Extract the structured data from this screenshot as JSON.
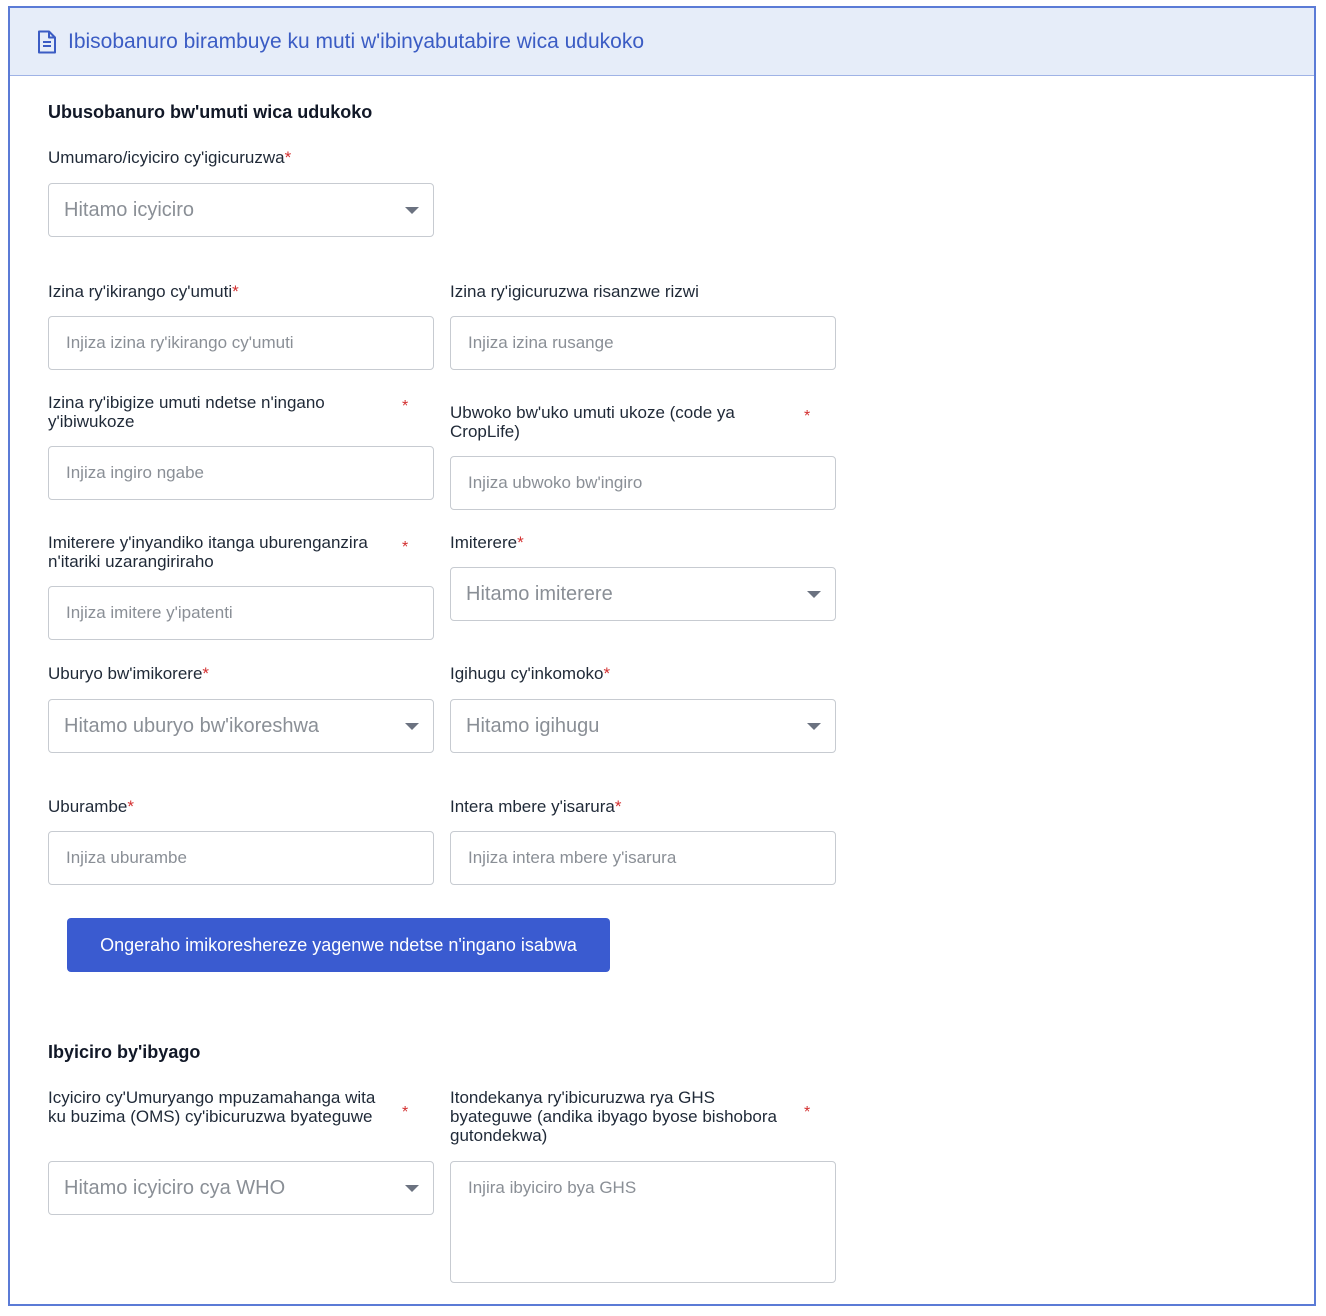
{
  "header": {
    "title": "Ibisobanuro birambuye ku muti w'ibinyabutabire wica udukoko",
    "icon": "document-icon"
  },
  "section1": {
    "title": "Ubusobanuro bw'umuti wica udukoko",
    "category": {
      "label": "Umumaro/icyiciro cy'igicuruzwa",
      "selected": "Hitamo icyiciro"
    },
    "brand_name": {
      "label": "Izina ry'ikirango cy'umuti",
      "placeholder": "Injiza izina ry'ikirango cy'umuti"
    },
    "common_name": {
      "label": "Izina ry'igicuruzwa risanzwe rizwi",
      "placeholder": "Injiza izina rusange"
    },
    "ingredients": {
      "label": "Izina ry'ibigize umuti ndetse n'ingano y'ibiwukoze",
      "placeholder": "Injiza ingiro ngabe"
    },
    "formulation": {
      "label": "Ubwoko bw'uko umuti ukoze (code ya CropLife)",
      "placeholder": "Injiza ubwoko bw'ingiro"
    },
    "patent": {
      "label": "Imiterere y'inyandiko itanga uburenganzira n'itariki uzarangiriraho",
      "placeholder": "Injiza imitere y'ipatenti"
    },
    "state": {
      "label": "Imiterere",
      "selected": "Hitamo imiterere"
    },
    "usage": {
      "label": "Uburyo bw'imikorere",
      "selected": "Hitamo uburyo bw'ikoreshwa"
    },
    "country": {
      "label": "Igihugu cy'inkomoko",
      "selected": "Hitamo igihugu"
    },
    "flavor": {
      "label": "Uburambe",
      "placeholder": "Injiza uburambe"
    },
    "preharvest": {
      "label": "Intera mbere y'isarura",
      "placeholder": "Injiza intera mbere y'isarura"
    },
    "add_button": "Ongeraho imikoreshereze yagenwe ndetse n'ingano isabwa"
  },
  "section2": {
    "title": "Ibyiciro by'ibyago",
    "who": {
      "label": "Icyiciro cy'Umuryango mpuzamahanga wita ku buzima (OMS) cy'ibicuruzwa byateguwe",
      "selected": "Hitamo icyiciro cya WHO"
    },
    "ghs": {
      "label": "Itondekanya ry'ibicuruzwa rya GHS byateguwe (andika ibyago byose bishobora gutondekwa)",
      "placeholder": "Injira ibyiciro bya GHS"
    }
  },
  "required_mark": "*",
  "colors": {
    "accent": "#3a5bd0",
    "header_bg": "#e6edf9",
    "required": "#d32f2f"
  }
}
